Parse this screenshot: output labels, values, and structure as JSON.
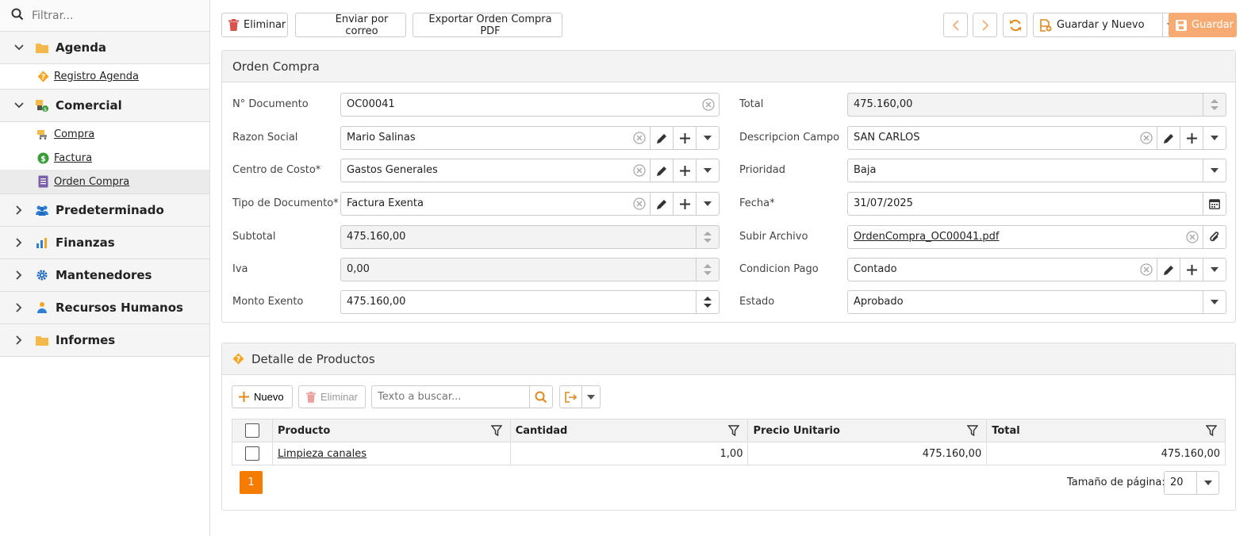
{
  "sidebar": {
    "filter_placeholder": "Filtrar...",
    "groups": [
      {
        "label": "Agenda",
        "icon": "folder-icon",
        "expanded": true,
        "items": [
          {
            "label": "Registro Agenda",
            "icon": "help-icon"
          }
        ]
      },
      {
        "label": "Comercial",
        "icon": "commerce-icon",
        "expanded": true,
        "items": [
          {
            "label": "Compra",
            "icon": "cart-icon"
          },
          {
            "label": "Factura",
            "icon": "dollar-icon"
          },
          {
            "label": "Orden Compra",
            "icon": "document-icon",
            "active": true
          }
        ]
      },
      {
        "label": "Predeterminado",
        "icon": "users-icon",
        "expanded": false
      },
      {
        "label": "Finanzas",
        "icon": "chart-icon",
        "expanded": false
      },
      {
        "label": "Mantenedores",
        "icon": "gear-icon",
        "expanded": false
      },
      {
        "label": "Recursos Humanos",
        "icon": "person-icon",
        "expanded": false
      },
      {
        "label": "Informes",
        "icon": "folder-icon",
        "expanded": false
      }
    ]
  },
  "toolbar": {
    "delete_label": "Eliminar",
    "email_label": "Enviar por correo",
    "export_label": "Exportar Orden Compra PDF",
    "save_new_label": "Guardar y Nuevo",
    "save_label": "Guardar"
  },
  "form": {
    "title": "Orden Compra",
    "fields": {
      "doc_number": {
        "label": "N° Documento",
        "value": "OC00041"
      },
      "razon_social": {
        "label": "Razon Social",
        "value": "Mario Salinas"
      },
      "centro_costo": {
        "label": "Centro de Costo*",
        "value": "Gastos Generales"
      },
      "tipo_documento": {
        "label": "Tipo de Documento*",
        "value": "Factura Exenta"
      },
      "subtotal": {
        "label": "Subtotal",
        "value": "475.160,00"
      },
      "iva": {
        "label": "Iva",
        "value": "0,00"
      },
      "monto_exento": {
        "label": "Monto Exento",
        "value": "475.160,00"
      },
      "total": {
        "label": "Total",
        "value": "475.160,00"
      },
      "descripcion_campo": {
        "label": "Descripcion Campo",
        "value": "SAN CARLOS"
      },
      "prioridad": {
        "label": "Prioridad",
        "value": "Baja"
      },
      "fecha": {
        "label": "Fecha*",
        "value": "31/07/2025"
      },
      "subir_archivo": {
        "label": "Subir Archivo",
        "value": "OrdenCompra_OC00041.pdf"
      },
      "condicion_pago": {
        "label": "Condicion Pago",
        "value": "Contado"
      },
      "estado": {
        "label": "Estado",
        "value": "Aprobado"
      }
    }
  },
  "detail": {
    "title": "Detalle de Productos",
    "new_label": "Nuevo",
    "delete_label": "Eliminar",
    "search_placeholder": "Texto a buscar...",
    "columns": [
      "Producto",
      "Cantidad",
      "Precio Unitario",
      "Total"
    ],
    "rows": [
      {
        "producto": "Limpieza canales",
        "cantidad": "1,00",
        "precio": "475.160,00",
        "total": "475.160,00"
      }
    ],
    "page": "1",
    "page_size_label": "Tamaño de página:",
    "page_size": "20"
  },
  "colors": {
    "accent": "#f57c00",
    "save": "#f7ab73",
    "delete": "#d9534f"
  }
}
